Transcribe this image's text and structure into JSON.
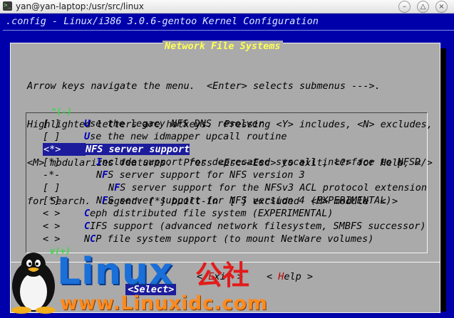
{
  "window": {
    "title": "yan@yan-laptop:/usr/src/linux",
    "icon": "terminal-icon",
    "controls": [
      "minimize",
      "maximize",
      "close"
    ]
  },
  "config_title": ".config - Linux/i386 3.0.6-gentoo Kernel Configuration",
  "dialog": {
    "title": "Network File Systems",
    "help_lines": [
      "Arrow keys navigate the menu.  <Enter> selects submenus --->.",
      "Highlighted letters are hotkeys.  Pressing <Y> includes, <N> excludes,",
      "<M> modularizes features.  Press <Esc><Esc> to exit, <?> for Help, </>",
      "for Search.  Legend: [*] built-in  [ ] excluded  <M> module  < >"
    ],
    "scroll_up": "^(-)",
    "scroll_down": "v(+)",
    "items": [
      {
        "prefix": "[ ]",
        "indent": 0,
        "hotkey": "U",
        "rest": "se the legacy NFS DNS resolver"
      },
      {
        "prefix": "[ ]",
        "indent": 0,
        "hotkey": "U",
        "rest": "se the new idmapper upcall routine"
      },
      {
        "prefix": "<*>",
        "indent": 0,
        "hotkey": "",
        "rest": "NFS server support",
        "selected": true
      },
      {
        "prefix": "[*]",
        "indent": 1,
        "hotkey": "I",
        "rest": "nclude support for deprecated syscall interface to NFSD"
      },
      {
        "prefix": "-*-",
        "indent": 1,
        "lead": "N",
        "hotkey": "F",
        "rest": "S server support for NFS version 3"
      },
      {
        "prefix": "[ ]",
        "indent": 2,
        "lead": "N",
        "hotkey": "F",
        "rest": "S server support for the NFSv3 ACL protocol extension"
      },
      {
        "prefix": "[*]",
        "indent": 1,
        "lead": "N",
        "hotkey": "F",
        "rest": "S server support for NFS version 4 (EXPERIMENTAL)"
      },
      {
        "prefix": "< >",
        "indent": 0,
        "hotkey": "C",
        "rest": "eph distributed file system (EXPERIMENTAL)"
      },
      {
        "prefix": "< >",
        "indent": 0,
        "hotkey": "C",
        "rest": "IFS support (advanced network filesystem, SMBFS successor)"
      },
      {
        "prefix": "< >",
        "indent": 0,
        "lead": "N",
        "hotkey": "C",
        "rest": "P file system support (to mount NetWare volumes)"
      }
    ],
    "buttons": {
      "select": "<Select>",
      "exit_pre": "< ",
      "exit_hot": "E",
      "exit_rest": "xit >",
      "help_pre": "< ",
      "help_hot": "H",
      "help_rest": "elp >"
    }
  },
  "watermark": {
    "logo": "Linux",
    "cn": "公社",
    "url": "www.Linuxidc.com"
  },
  "colors": {
    "terminal_bg": "#0000aa",
    "dialog_bg": "#aaaaaa",
    "title_yellow": "#ffff55",
    "hotkey_blue": "#0000bb",
    "selected_bg": "#1c1c9c"
  }
}
